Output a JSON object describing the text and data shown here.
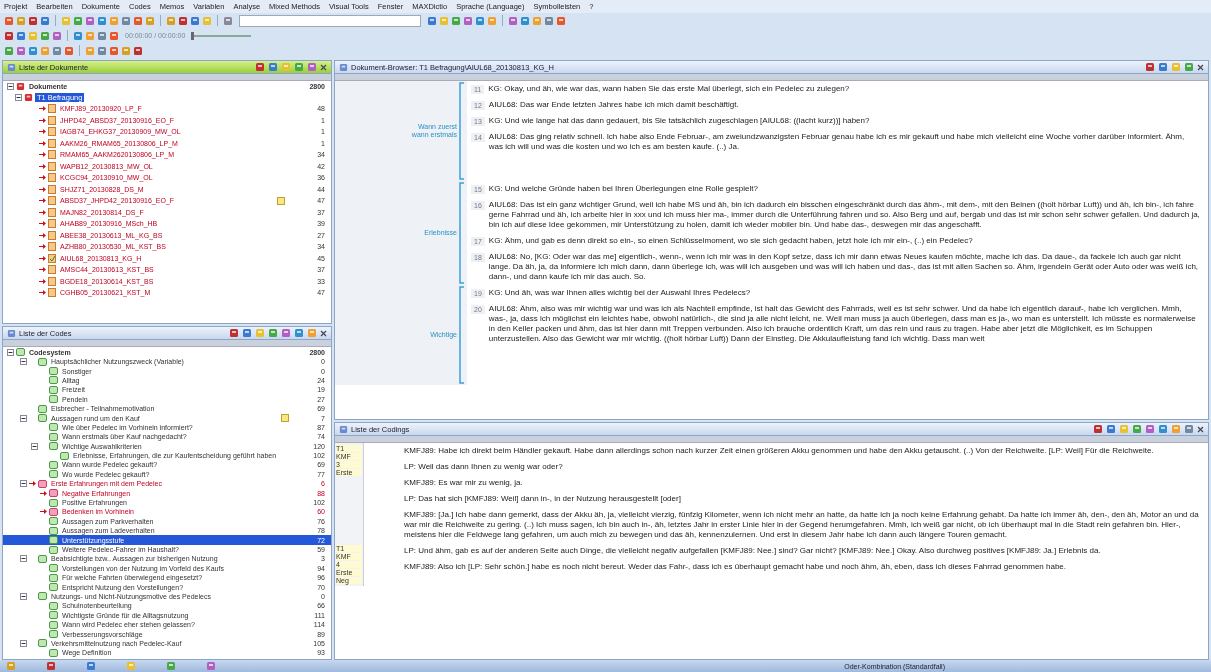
{
  "menu": [
    "Projekt",
    "Bearbeiten",
    "Dokumente",
    "Codes",
    "Memos",
    "Variablen",
    "Analyse",
    "Mixed Methods",
    "Visual Tools",
    "Fenster",
    "MAXDictio",
    "Sprache (Language)",
    "Symbolleisten",
    "?"
  ],
  "media_time": "00:00:00 / 00:00:00",
  "media_position": {
    "level": 0.0
  },
  "documents_panel": {
    "title": "Liste der Dokumente",
    "active": true,
    "root": {
      "label": "Dokumente",
      "count": "2800"
    },
    "group": {
      "label": "T1 Befragung",
      "selected": true,
      "expanded": true
    },
    "items": [
      {
        "label": "KMFJ89_20130920_LP_F",
        "count": "48",
        "activated": true,
        "memo": false,
        "open": false
      },
      {
        "label": "JHPD42_ABSD37_20130916_EO_F",
        "count": "1",
        "activated": true,
        "memo": false,
        "open": false
      },
      {
        "label": "IAGB74_EHKG37_20130909_MW_OL",
        "count": "1",
        "activated": true,
        "memo": false,
        "open": false
      },
      {
        "label": "AAKM26_RMAM65_20130806_LP_M",
        "count": "1",
        "activated": true,
        "memo": false,
        "open": false
      },
      {
        "label": "RMAM65_AAKM2620130806_LP_M",
        "count": "34",
        "activated": true,
        "memo": false,
        "open": false
      },
      {
        "label": "WAPB12_20130813_MW_OL",
        "count": "42",
        "activated": true,
        "memo": false,
        "open": false
      },
      {
        "label": "KCGC94_20130910_MW_OL",
        "count": "36",
        "activated": true,
        "memo": false,
        "open": false
      },
      {
        "label": "SHJZ71_20130828_DS_M",
        "count": "44",
        "activated": true,
        "memo": false,
        "open": false
      },
      {
        "label": "ABSD37_JHPD42_20130916_EO_F",
        "count": "47",
        "activated": true,
        "memo": true,
        "open": false
      },
      {
        "label": "MAJN82_20130814_DS_F",
        "count": "37",
        "activated": true,
        "memo": false,
        "open": false
      },
      {
        "label": "AHAB89_20130916_MSch_HB",
        "count": "39",
        "activated": true,
        "memo": false,
        "open": false
      },
      {
        "label": "ABEE38_20130613_ML_KG_BS",
        "count": "27",
        "activated": true,
        "memo": false,
        "open": false
      },
      {
        "label": "AZHB80_20130530_ML_KST_BS",
        "count": "34",
        "activated": true,
        "memo": false,
        "open": false
      },
      {
        "label": "AIUL68_20130813_KG_H",
        "count": "45",
        "activated": true,
        "memo": false,
        "open": true
      },
      {
        "label": "AMSC44_20130613_KST_BS",
        "count": "37",
        "activated": true,
        "memo": false,
        "open": false
      },
      {
        "label": "BGDE18_20130614_KST_BS",
        "count": "33",
        "activated": true,
        "memo": false,
        "open": false
      },
      {
        "label": "CGHB05_20130621_KST_M",
        "count": "47",
        "activated": true,
        "memo": false,
        "open": false
      }
    ]
  },
  "codes_panel": {
    "title": "Liste der Codes",
    "active": false,
    "root": {
      "label": "Codesystem",
      "count": "2800"
    },
    "items": [
      {
        "label": "Hauptsächlicher Nutzungszweck (Variable)",
        "count": "0",
        "activated": false,
        "selected": false,
        "memo": false,
        "expanded": true,
        "children": [
          {
            "label": "Sonstiger",
            "count": "0",
            "activated": false,
            "selected": false,
            "memo": false
          },
          {
            "label": "Alltag",
            "count": "24",
            "activated": false,
            "selected": false,
            "memo": false
          },
          {
            "label": "Freizeit",
            "count": "19",
            "activated": false,
            "selected": false,
            "memo": false
          },
          {
            "label": "Pendeln",
            "count": "27",
            "activated": false,
            "selected": false,
            "memo": false
          }
        ]
      },
      {
        "label": "Eisbrecher - Teilnahmemotivation",
        "count": "69",
        "activated": false,
        "selected": false,
        "memo": false
      },
      {
        "label": "Aussagen rund um den Kauf",
        "count": "7",
        "activated": false,
        "selected": false,
        "memo": true,
        "expanded": true,
        "children": [
          {
            "label": "Wie über Pedelec im Vorhinein informiert?",
            "count": "87",
            "activated": false,
            "selected": false,
            "memo": false
          },
          {
            "label": "Wann erstmals über Kauf nachgedacht?",
            "count": "74",
            "activated": false,
            "selected": false,
            "memo": false
          },
          {
            "label": "Wichtige Auswahlkriterien",
            "count": "120",
            "activated": false,
            "selected": false,
            "memo": false,
            "expanded": true,
            "children": [
              {
                "label": "Erlebnisse, Erfahrungen, die zur Kaufentscheidung geführt haben",
                "count": "102",
                "activated": false,
                "selected": false,
                "memo": false
              }
            ]
          },
          {
            "label": "Wann wurde Pedelec gekauft?",
            "count": "69",
            "activated": false,
            "selected": false,
            "memo": false
          },
          {
            "label": "Wo wurde Pedelec gekauft?",
            "count": "77",
            "activated": false,
            "selected": false,
            "memo": false
          }
        ]
      },
      {
        "label": "Erste Erfahrungen mit dem Pedelec",
        "count": "6",
        "activated": true,
        "selected": false,
        "memo": false,
        "expanded": true,
        "children": [
          {
            "label": "Negative Erfahrungen",
            "count": "88",
            "activated": true,
            "selected": false,
            "memo": false
          },
          {
            "label": "Positive Erfahrungen",
            "count": "102",
            "activated": false,
            "selected": false,
            "memo": false
          },
          {
            "label": "Bedenken im Vorhinein",
            "count": "60",
            "activated": true,
            "selected": false,
            "memo": false
          },
          {
            "label": "Aussagen zum Parkverhalten",
            "count": "76",
            "activated": false,
            "selected": false,
            "memo": false
          },
          {
            "label": "Aussagen zum Ladeverhalten",
            "count": "78",
            "activated": false,
            "selected": false,
            "memo": false
          },
          {
            "label": "Unterstützungsstufe",
            "count": "72",
            "activated": false,
            "selected": true,
            "memo": false
          },
          {
            "label": "Weitere Pedelec-Fahrer im Haushalt?",
            "count": "59",
            "activated": false,
            "selected": false,
            "memo": false
          }
        ]
      },
      {
        "label": "Beabsichtigte bzw.. Aussagen zur bisherigen Nutzung",
        "count": "3",
        "activated": false,
        "selected": false,
        "memo": false,
        "expanded": true,
        "children": [
          {
            "label": "Vorstellungen von der Nutzung im Vorfeld des Kaufs",
            "count": "94",
            "activated": false,
            "selected": false,
            "memo": false
          },
          {
            "label": "Für welche Fahrten überwiegend eingesetzt?",
            "count": "96",
            "activated": false,
            "selected": false,
            "memo": false
          },
          {
            "label": "Entspricht Nutzung den Vorstellungen?",
            "count": "70",
            "activated": false,
            "selected": false,
            "memo": false
          }
        ]
      },
      {
        "label": "Nutzungs- und Nicht-Nutzungsmotive des Pedelecs",
        "count": "0",
        "activated": false,
        "selected": false,
        "memo": false,
        "expanded": true,
        "children": [
          {
            "label": "Schulnotenbeurteilung",
            "count": "66",
            "activated": false,
            "selected": false,
            "memo": false
          },
          {
            "label": "Wichtigste Gründe für die Alltagsnutzung",
            "count": "111",
            "activated": false,
            "selected": false,
            "memo": false
          },
          {
            "label": "Wann wird Pedelec eher stehen gelassen?",
            "count": "114",
            "activated": false,
            "selected": false,
            "memo": false
          },
          {
            "label": "Verbesserungsvorschläge",
            "count": "89",
            "activated": false,
            "selected": false,
            "memo": false
          }
        ]
      },
      {
        "label": "Verkehrsmittelnutzung nach Pedelec-Kauf",
        "count": "105",
        "activated": false,
        "selected": false,
        "memo": false,
        "expanded": true,
        "children": [
          {
            "label": "Wege Definition",
            "count": "93",
            "activated": false,
            "selected": false,
            "memo": false
          }
        ]
      }
    ]
  },
  "document_browser": {
    "title": "Dokument-Browser: T1 Befragung\\AIUL68_20130813_KG_H",
    "active": false,
    "segments": [
      {
        "labels": [
          "Wann zuerst",
          "wann erstmals"
        ],
        "paragraphs": [
          {
            "number": "11",
            "text": "KG: Okay, und äh, wie war das, wann haben Sie das erste Mal überlegt, sich ein Pedelec zu zulegen?"
          },
          {
            "number": "12",
            "text": "AIUL68: Das war Ende letzten Jahres habe ich mich damit beschäftigt."
          },
          {
            "number": "13",
            "text": "KG: Und wie lange hat das dann gedauert, bis Sie tatsächlich zugeschlagen [AIUL68: ((lacht kurz))] haben?"
          },
          {
            "number": "14",
            "text": "AIUL68: Das ging relativ schnell. Ich habe also Ende Februar-, am zweiundzwanzigsten Februar genau habe ich es mir gekauft und habe mich vielleicht eine Woche vorher darüber informiert. Ähm, was ich will und was die kosten und wo ich es am besten kaufe. (..) Ja."
          }
        ]
      },
      {
        "labels": [
          "Erlebnisse"
        ],
        "paragraphs": [
          {
            "number": "15",
            "text": "KG: Und welche Gründe haben bei Ihren Überlegungen eine Rolle gespielt?"
          },
          {
            "number": "16",
            "text": "AIUL68: Das ist ein ganz wichtiger Grund, weil ich habe MS und äh, bin ich dadurch ein bisschen eingeschränkt durch das ähm-, mit dem-, mit den Beinen ((holt hörbar Luft)) und äh, ich bin-, ich fahre gerne Fahrrad und äh, ich arbeite hier in xxx und ich muss hier ma-, immer durch die Unterführung fahren und so. Also Berg und auf, bergab und das ist mir schon sehr schwer gefallen. Und dadurch ja, bin ich auf diese Idee gekommen, mir Unterstützung zu holen, damit ich wieder mobiler bin. Und habe das-, deswegen mir das angeschafft."
          },
          {
            "number": "17",
            "text": "KG: Ähm, und gab es denn direkt so ein-, so einen Schlüsselmoment, wo sie sich gedacht haben, jetzt hole ich mir ein-, (..) ein Pedelec?"
          },
          {
            "number": "18",
            "text": "AIUL68: No, [KG: Oder war das me] eigentlich-, wenn-, wenn ich mir was in den Kopf setze, dass ich mir dann etwas Neues kaufen möchte, mache ich das. Da daue-, da fackele ich auch gar nicht lange. Da äh, ja, da informiere ich mich dann, dann überlege ich, was will ich ausgeben und was will ich haben und das-, das ist mit allen Sachen so. Ähm, irgendein Gerät oder Auto oder was weiß ich, dann-, und dann kaufe ich mir das auch. So."
          }
        ]
      },
      {
        "labels": [
          "Wichtige"
        ],
        "paragraphs": [
          {
            "number": "19",
            "text": "KG: Und äh, was war Ihnen alles wichtig bei der Auswahl Ihres Pedelecs?"
          },
          {
            "number": "20",
            "text": "AIUL68: Ähm, also was mir wichtig war und was ich als Nachteil empfinde, ist halt das Gewicht des Fahrrads, weil es ist sehr schwer. Und da habe ich eigentlich darauf-, habe ich verglichen. Mmh, was-, ja, dass ich möglichst ein leichtes habe, obwohl natürlich-, die sind ja alle nicht leicht, ne. Weil man muss ja auch überlegen, dass man es ja-, wo man es unterstellt. Ich müsste es normalerweise in den Keller packen und ähm, das ist hier dann mit Treppen verbunden. Also ich brauche ordentlich Kraft, um das rein und raus zu tragen. Habe aber jetzt die Möglichkeit, es im Schuppen unterzustellen. Also das Gewicht war mir wichtig. ((holt hörbar Luft)) Dann der Einstieg. Die Akkulaufleistung fand ich wichtig. Dass man weit"
          }
        ]
      }
    ]
  },
  "codings_panel": {
    "title": "Liste der Codings",
    "active": false,
    "segments": [
      {
        "source": [
          "T1",
          "KMF",
          "3",
          "Erste"
        ],
        "paragraphs": [
          "KMFJ89: Habe ich direkt beim Händler gekauft. Habe dann allerdings schon nach kurzer Zeit einen größeren Akku genommen und habe den Akku getauscht. (..) Von der Reichweite. [LP: Weil] Für die Reichweite.",
          "LP: Weil das dann Ihnen zu wenig war oder?",
          "KMFJ89: Es war mir zu wenig, ja.",
          "LP: Das hat sich [KMFJ89: Weil] dann in-, in der Nutzung herausgestellt [oder]",
          "KMFJ89: [Ja.] Ich habe dann gemerkt, dass der Akku äh, ja, vielleicht vierzig, fünfzig Kilometer, wenn ich nicht mehr an hatte, da hatte ich ja noch keine Erfahrung gehabt. Da hatte ich immer äh, den-, den äh, Motor an und da war mir die Reichweite zu gering. (..) Ich muss sagen, ich bin auch in-, äh, letztes Jahr in erster Linie hier in der Gegend herumgefahren. Mmh, ich weiß gar nicht, ob ich überhaupt mal in die Stadt rein gefahren bin. Hier-, meistens hier die Feldwege lang gefahren, um auch mich zu bewegen und das äh, kennenzulernen. Und erst in diesem Jahr habe ich dann auch längere Touren gemacht."
        ]
      },
      {
        "source": [
          "T1",
          "KMF",
          "4",
          "Erste",
          "Neg"
        ],
        "paragraphs": [
          "LP: Und ähm, gab es auf der anderen Seite auch Dinge, die vielleicht negativ aufgefallen [KMFJ89: Nee.] sind? Gar nicht? [KMFJ89: Nee.] Okay. Also durchweg positives [KMFJ89: Ja.] Erlebnis da.",
          "KMFJ89: Also ich [LP: Sehr schön.] habe es noch nicht bereut. Weder das Fahr-, dass ich es überhaupt gemacht habe und noch ähm, äh, eben, dass ich dieses Fahrrad genommen habe."
        ]
      }
    ]
  },
  "status_bar": {
    "combination": "Oder-Kombination (Standardfall)"
  }
}
